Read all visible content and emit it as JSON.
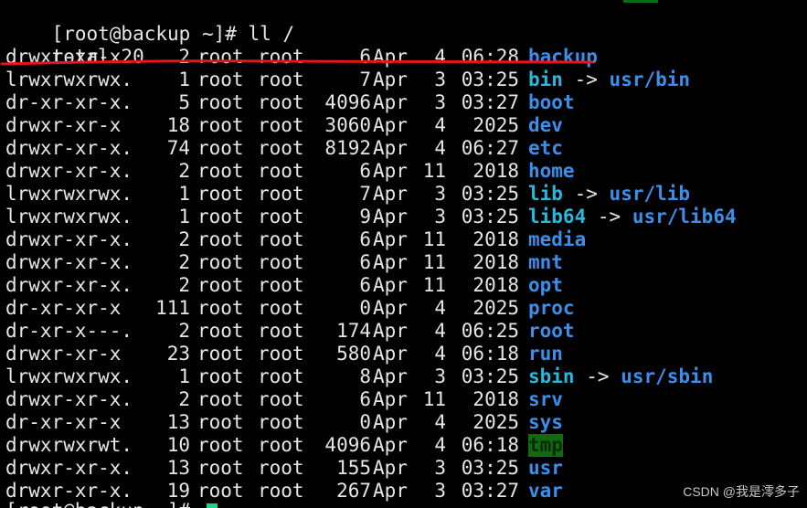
{
  "terminal": {
    "prompt": "[root@backup ~]# ll /",
    "total": "total 20",
    "entries": [
      {
        "perm": "drwxr-xr-x",
        "links": "2",
        "owner": "root",
        "group": "root",
        "size": "6",
        "month": "Apr",
        "day": "4",
        "time": "06:28",
        "name": "backup",
        "type": "dir"
      },
      {
        "perm": "lrwxrwxrwx.",
        "links": "1",
        "owner": "root",
        "group": "root",
        "size": "7",
        "month": "Apr",
        "day": "3",
        "time": "03:25",
        "name": "bin",
        "type": "link",
        "target": "usr/bin"
      },
      {
        "perm": "dr-xr-xr-x.",
        "links": "5",
        "owner": "root",
        "group": "root",
        "size": "4096",
        "month": "Apr",
        "day": "3",
        "time": "03:27",
        "name": "boot",
        "type": "dir"
      },
      {
        "perm": "drwxr-xr-x",
        "links": "18",
        "owner": "root",
        "group": "root",
        "size": "3060",
        "month": "Apr",
        "day": "4",
        "time": "2025",
        "name": "dev",
        "type": "dir"
      },
      {
        "perm": "drwxr-xr-x.",
        "links": "74",
        "owner": "root",
        "group": "root",
        "size": "8192",
        "month": "Apr",
        "day": "4",
        "time": "06:27",
        "name": "etc",
        "type": "dir"
      },
      {
        "perm": "drwxr-xr-x.",
        "links": "2",
        "owner": "root",
        "group": "root",
        "size": "6",
        "month": "Apr",
        "day": "11",
        "time": "2018",
        "name": "home",
        "type": "dir"
      },
      {
        "perm": "lrwxrwxrwx.",
        "links": "1",
        "owner": "root",
        "group": "root",
        "size": "7",
        "month": "Apr",
        "day": "3",
        "time": "03:25",
        "name": "lib",
        "type": "link",
        "target": "usr/lib"
      },
      {
        "perm": "lrwxrwxrwx.",
        "links": "1",
        "owner": "root",
        "group": "root",
        "size": "9",
        "month": "Apr",
        "day": "3",
        "time": "03:25",
        "name": "lib64",
        "type": "link",
        "target": "usr/lib64"
      },
      {
        "perm": "drwxr-xr-x.",
        "links": "2",
        "owner": "root",
        "group": "root",
        "size": "6",
        "month": "Apr",
        "day": "11",
        "time": "2018",
        "name": "media",
        "type": "dir"
      },
      {
        "perm": "drwxr-xr-x.",
        "links": "2",
        "owner": "root",
        "group": "root",
        "size": "6",
        "month": "Apr",
        "day": "11",
        "time": "2018",
        "name": "mnt",
        "type": "dir"
      },
      {
        "perm": "drwxr-xr-x.",
        "links": "2",
        "owner": "root",
        "group": "root",
        "size": "6",
        "month": "Apr",
        "day": "11",
        "time": "2018",
        "name": "opt",
        "type": "dir"
      },
      {
        "perm": "dr-xr-xr-x",
        "links": "111",
        "owner": "root",
        "group": "root",
        "size": "0",
        "month": "Apr",
        "day": "4",
        "time": "2025",
        "name": "proc",
        "type": "dir"
      },
      {
        "perm": "dr-xr-x---.",
        "links": "2",
        "owner": "root",
        "group": "root",
        "size": "174",
        "month": "Apr",
        "day": "4",
        "time": "06:25",
        "name": "root",
        "type": "dir"
      },
      {
        "perm": "drwxr-xr-x",
        "links": "23",
        "owner": "root",
        "group": "root",
        "size": "580",
        "month": "Apr",
        "day": "4",
        "time": "06:18",
        "name": "run",
        "type": "dir"
      },
      {
        "perm": "lrwxrwxrwx.",
        "links": "1",
        "owner": "root",
        "group": "root",
        "size": "8",
        "month": "Apr",
        "day": "3",
        "time": "03:25",
        "name": "sbin",
        "type": "link",
        "target": "usr/sbin"
      },
      {
        "perm": "drwxr-xr-x.",
        "links": "2",
        "owner": "root",
        "group": "root",
        "size": "6",
        "month": "Apr",
        "day": "11",
        "time": "2018",
        "name": "srv",
        "type": "dir"
      },
      {
        "perm": "dr-xr-xr-x",
        "links": "13",
        "owner": "root",
        "group": "root",
        "size": "0",
        "month": "Apr",
        "day": "4",
        "time": "2025",
        "name": "sys",
        "type": "dir"
      },
      {
        "perm": "drwxrwxrwt.",
        "links": "10",
        "owner": "root",
        "group": "root",
        "size": "4096",
        "month": "Apr",
        "day": "4",
        "time": "06:18",
        "name": "tmp",
        "type": "sticky"
      },
      {
        "perm": "drwxr-xr-x.",
        "links": "13",
        "owner": "root",
        "group": "root",
        "size": "155",
        "month": "Apr",
        "day": "3",
        "time": "03:25",
        "name": "usr",
        "type": "dir"
      },
      {
        "perm": "drwxr-xr-x.",
        "links": "19",
        "owner": "root",
        "group": "root",
        "size": "267",
        "month": "Apr",
        "day": "3",
        "time": "03:27",
        "name": "var",
        "type": "dir"
      }
    ],
    "arrow": "->"
  },
  "colors": {
    "background": "#000000",
    "text": "#e6e6e6",
    "dir": "#3b8eea",
    "link": "#29b8db",
    "sticky_bg": "#0f6b0f",
    "annotation": "#e8141b",
    "cursor": "#23d18b"
  },
  "watermark": "CSDN @我是澪多子"
}
